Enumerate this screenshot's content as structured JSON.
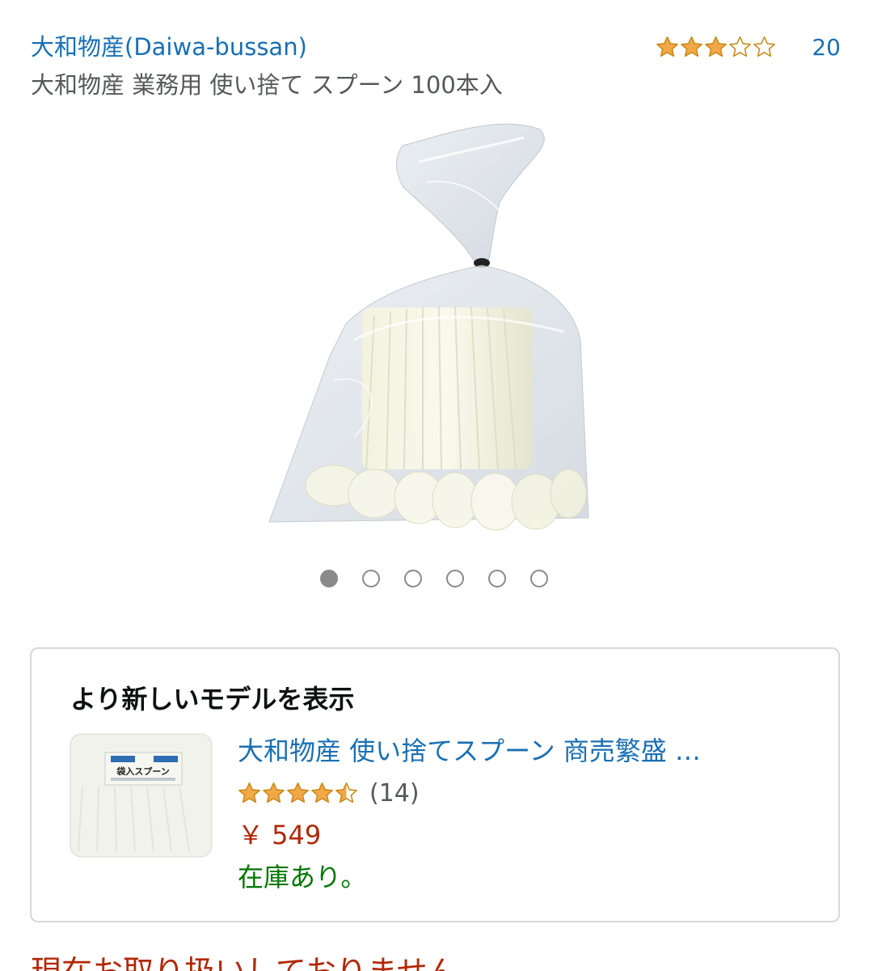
{
  "header": {
    "brand": "大和物産(Daiwa-bussan)",
    "rating_stars": 3,
    "rating_count": "20",
    "title": "大和物産 業務用 使い捨て スプーン 100本入"
  },
  "gallery": {
    "image_count": 6,
    "active_index": 0
  },
  "newer_model": {
    "heading": "より新しいモデルを表示",
    "thumb_label": "袋入スプーン",
    "name": "大和物産 使い捨てスプーン 商売繁盛 …",
    "rating_stars": 4.5,
    "rating_count": "(14)",
    "price": "￥ 549",
    "stock": "在庫あり。"
  },
  "availability": {
    "text": "現在お取り扱いしておりません。"
  },
  "colors": {
    "link": "#1a6fb3",
    "star": "#f3a847",
    "price": "#b12704",
    "in_stock": "#007600"
  }
}
